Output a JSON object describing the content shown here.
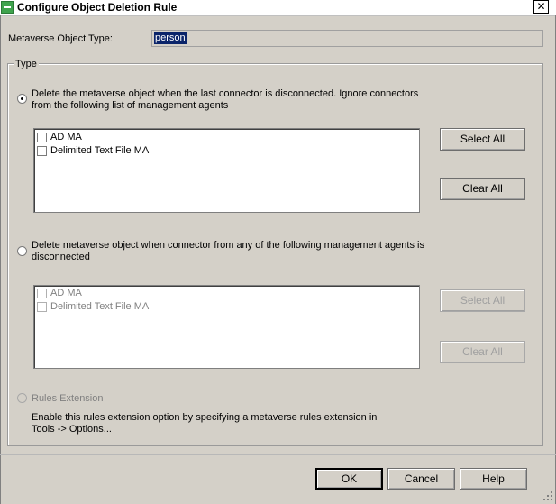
{
  "window": {
    "title": "Configure Object Deletion Rule",
    "close_glyph": "✕"
  },
  "object_type": {
    "label": "Metaverse Object Type:",
    "value": "person"
  },
  "type_group": {
    "legend": "Type",
    "option1": {
      "text_line1": "Delete the metaverse object when the last connector is disconnected. Ignore connectors",
      "text_line2": "from the following list of management agents",
      "selected": true,
      "items": [
        {
          "label": "AD MA",
          "checked": false
        },
        {
          "label": "Delimited Text File MA",
          "checked": false
        }
      ],
      "select_all": "Select All",
      "clear_all": "Clear All"
    },
    "option2": {
      "text_line1": "Delete metaverse object when connector from any of the following management agents is",
      "text_line2": "disconnected",
      "selected": false,
      "items": [
        {
          "label": "AD MA",
          "checked": false
        },
        {
          "label": "Delimited Text File MA",
          "checked": false
        }
      ],
      "select_all": "Select All",
      "clear_all": "Clear All"
    },
    "option3": {
      "label": "Rules Extension",
      "desc_line1": "Enable this rules extension option by specifying a metaverse rules extension in",
      "desc_line2": "Tools -> Options..."
    }
  },
  "footer": {
    "ok": "OK",
    "cancel": "Cancel",
    "help": "Help"
  }
}
